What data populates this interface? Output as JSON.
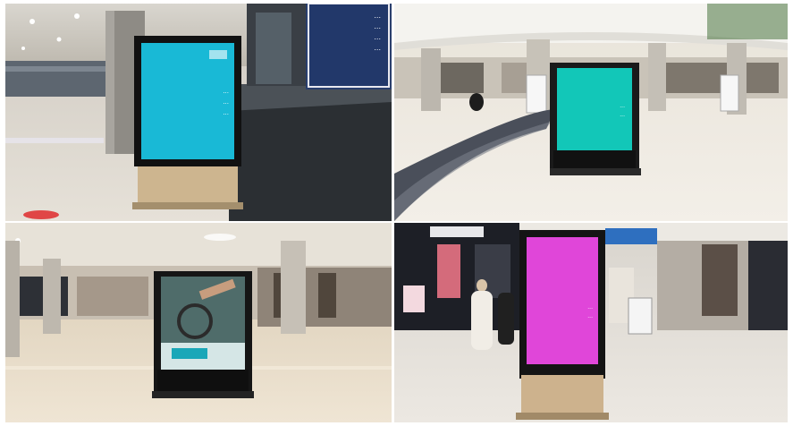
{
  "collage": {
    "panels": [
      {
        "id": "top-left",
        "screen_color": "#19b9d6",
        "screen_text_lines": [
          "...",
          "...",
          "..."
        ],
        "overhead_sign_lines": [
          "...",
          "...",
          "...",
          "..."
        ]
      },
      {
        "id": "top-right",
        "screen_color": "#12c7b8",
        "screen_text_lines": [
          "...",
          "..."
        ]
      },
      {
        "id": "bottom-left",
        "screen_color": "#1aa7b8",
        "screen_text_lines": []
      },
      {
        "id": "bottom-right",
        "screen_color": "#e046d9",
        "screen_text_lines": [
          "...",
          "..."
        ]
      }
    ]
  }
}
